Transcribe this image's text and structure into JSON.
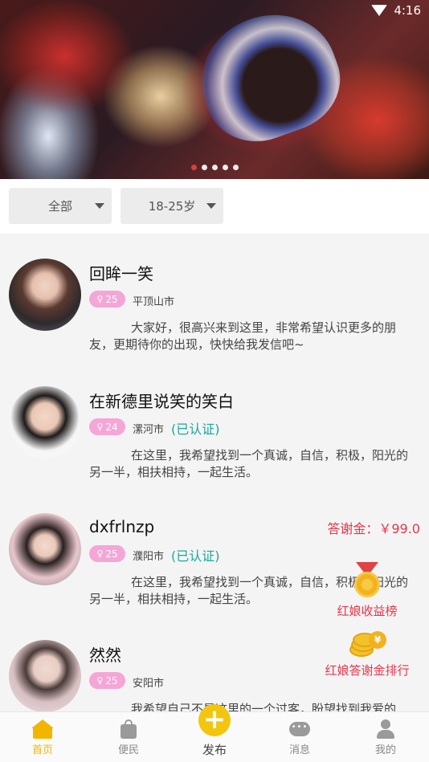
{
  "status_bar": {
    "time": "4:16"
  },
  "banner": {
    "dots": 5,
    "active_dot": 0
  },
  "filters": [
    {
      "label": "全部"
    },
    {
      "label": "18-25岁"
    }
  ],
  "profiles": [
    {
      "name": "回眸一笑",
      "age": "25",
      "city": "平顶山市",
      "verified": "",
      "reward": "",
      "intro": "大家好，很高兴来到这里，非常希望认识更多的朋友，更期待你的出现，快快给我发信吧~"
    },
    {
      "name": "在新德里说笑的笑白",
      "age": "24",
      "city": "漯河市",
      "verified": "(已认证)",
      "reward": "",
      "intro": "在这里，我希望找到一个真诚，自信，积极，阳光的另一半，相扶相持，一起生活。"
    },
    {
      "name": "dxfrlnzp",
      "age": "25",
      "city": "濮阳市",
      "verified": "(已认证)",
      "reward": "答谢金：￥99.0",
      "intro": "在这里，我希望找到一个真诚，自信，积极，阳光的另一半，相扶相持，一起生活。"
    },
    {
      "name": "然然",
      "age": "25",
      "city": "安阳市",
      "verified": "",
      "reward": "",
      "intro": "我希望自己不是这里的一个过客，盼望找到我爱的"
    }
  ],
  "floating": {
    "income_rank": "红娘收益榜",
    "thanks_rank": "红娘答谢金排行"
  },
  "tabbar": [
    {
      "label": "首页",
      "icon": "home-icon"
    },
    {
      "label": "便民",
      "icon": "bag-icon"
    },
    {
      "label": "发布",
      "icon": "plus-icon"
    },
    {
      "label": "消息",
      "icon": "message-icon"
    },
    {
      "label": "我的",
      "icon": "user-icon"
    }
  ],
  "colors": {
    "accent": "#f2b600",
    "badge": "#f4a6d6",
    "verified": "#1aa89a",
    "reward": "#e8354a"
  }
}
